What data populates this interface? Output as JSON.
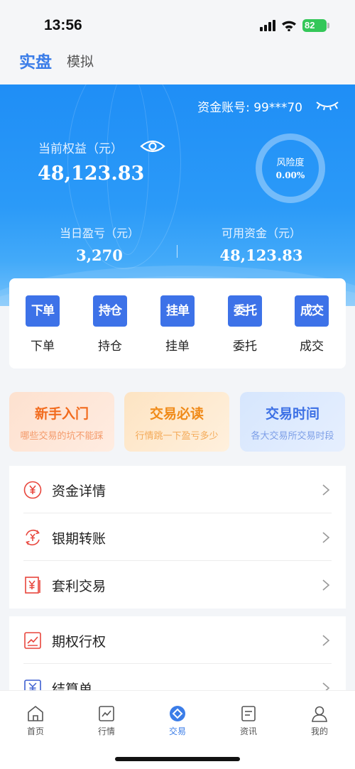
{
  "status_bar": {
    "time": "13:56",
    "battery": "82"
  },
  "mode_tabs": {
    "real": "实盘",
    "sim": "模拟"
  },
  "hero": {
    "account_label": "资金账号: 99***70",
    "equity_label": "当前权益（元）",
    "equity_value": "48,123.83",
    "risk_label": "风险度",
    "risk_value": "0.00%",
    "daily_pnl_label": "当日盈亏（元）",
    "daily_pnl_value": "3,270",
    "available_label": "可用资金（元）",
    "available_value": "48,123.83"
  },
  "actions": [
    {
      "icon_text": "下单",
      "label": "下单"
    },
    {
      "icon_text": "持仓",
      "label": "持仓"
    },
    {
      "icon_text": "挂单",
      "label": "挂单"
    },
    {
      "icon_text": "委托",
      "label": "委托"
    },
    {
      "icon_text": "成交",
      "label": "成交"
    }
  ],
  "promos": [
    {
      "title": "新手入门",
      "subtitle": "哪些交易的坑不能踩"
    },
    {
      "title": "交易必读",
      "subtitle": "行情跳一下盈亏多少"
    },
    {
      "title": "交易时间",
      "subtitle": "各大交易所交易时段"
    }
  ],
  "menu_group_1": [
    {
      "label": "资金详情",
      "icon": "yuan-circle-icon"
    },
    {
      "label": "银期转账",
      "icon": "transfer-icon"
    },
    {
      "label": "套利交易",
      "icon": "arbitrage-icon"
    }
  ],
  "menu_group_2": [
    {
      "label": "期权行权",
      "icon": "chart-line-icon"
    },
    {
      "label": "结算单",
      "icon": "settlement-icon"
    }
  ],
  "bottom_nav": [
    {
      "label": "首页",
      "icon": "home-icon"
    },
    {
      "label": "行情",
      "icon": "market-chart-icon"
    },
    {
      "label": "交易",
      "icon": "trade-icon"
    },
    {
      "label": "资讯",
      "icon": "news-icon"
    },
    {
      "label": "我的",
      "icon": "user-icon"
    }
  ],
  "colors": {
    "primary": "#3b7de8",
    "hero": "#1f8ef6",
    "icon_red": "#e8453c",
    "action_blue": "#3d72e8"
  }
}
